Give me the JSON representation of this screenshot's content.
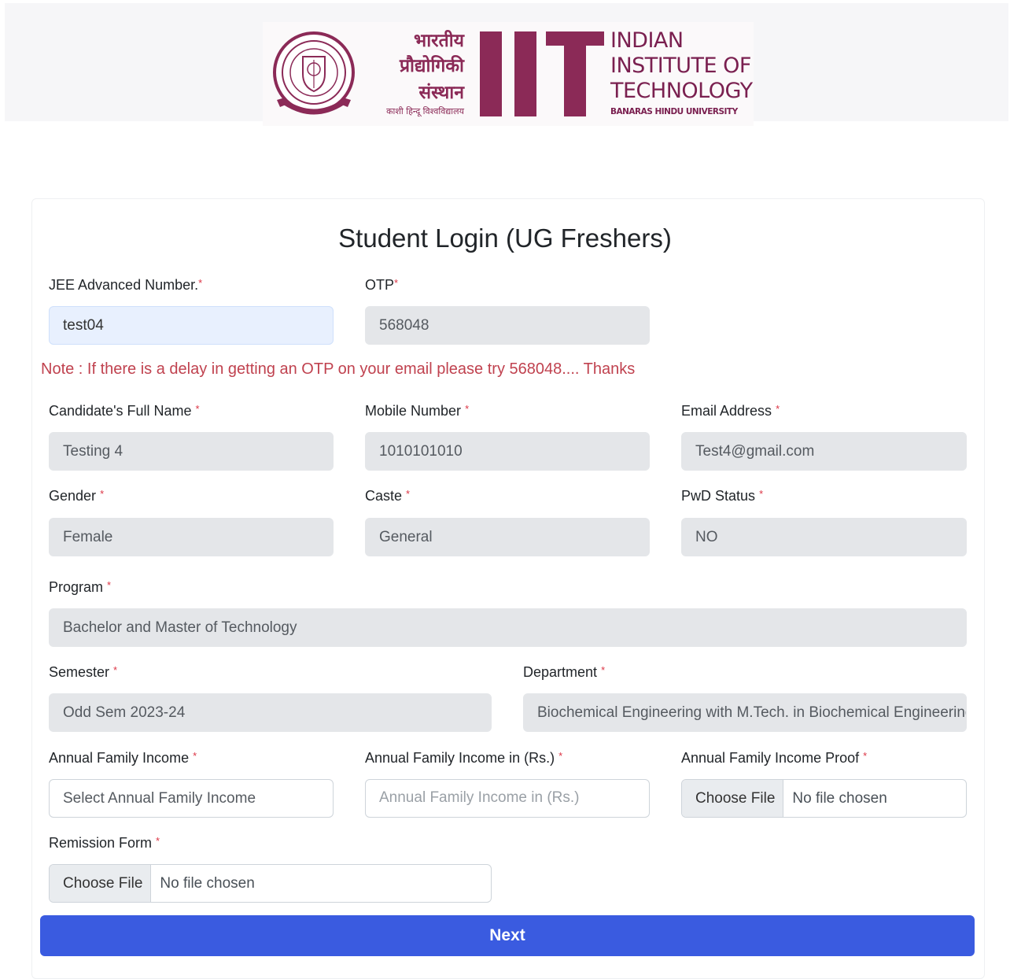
{
  "header": {
    "logo": {
      "hindi_line1": "भारतीय",
      "hindi_line2": "प्रौद्योगिकी",
      "hindi_line3": "संस्थान",
      "hindi_line4": "काशी हिन्दू विश्वविद्यालय",
      "english_line1": "INDIAN",
      "english_line2": "INSTITUTE OF",
      "english_line3": "TECHNOLOGY",
      "english_line4": "BANARAS HINDU UNIVERSITY",
      "brand_color": "#8b2a57"
    }
  },
  "form": {
    "title": "Student Login (UG Freshers)",
    "jee": {
      "label": "JEE Advanced Number.",
      "value": "test04"
    },
    "otp": {
      "label": "OTP",
      "value": "568048"
    },
    "note": {
      "prefix": "Note :",
      "text": " If there is a delay in getting an OTP on your email please try 568048.... Thanks"
    },
    "name": {
      "label": "Candidate's Full Name",
      "value": "Testing 4"
    },
    "mobile": {
      "label": "Mobile Number",
      "value": "1010101010"
    },
    "email": {
      "label": "Email Address",
      "value": "Test4@gmail.com"
    },
    "gender": {
      "label": "Gender",
      "value": "Female"
    },
    "caste": {
      "label": "Caste",
      "value": "General"
    },
    "pwd": {
      "label": "PwD Status",
      "value": "NO"
    },
    "program": {
      "label": "Program",
      "value": "Bachelor and Master of Technology"
    },
    "semester": {
      "label": "Semester",
      "value": "Odd Sem 2023-24"
    },
    "department": {
      "label": "Department",
      "value": "Biochemical Engineering with M.Tech. in Biochemical Engineering"
    },
    "income": {
      "label": "Annual Family Income",
      "placeholder": "Select Annual Family Income"
    },
    "income_rs": {
      "label": "Annual Family Income in (Rs.)",
      "placeholder": "Annual Family Income in (Rs.)"
    },
    "income_proof": {
      "label": "Annual Family Income Proof",
      "button": "Choose File",
      "status": "No file chosen"
    },
    "remission": {
      "label": "Remission Form",
      "button": "Choose File",
      "status": "No file chosen"
    },
    "required_mark": "*",
    "next_label": "Next",
    "accent_color": "#3a5be0",
    "note_color": "#c0424f"
  }
}
